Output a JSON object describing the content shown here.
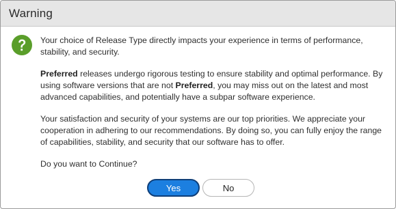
{
  "dialog": {
    "title": "Warning",
    "icon": "question-mark-icon",
    "accent_color": "#5a9e2a",
    "para1": "Your choice of Release Type directly impacts your experience in terms of performance, stability, and security.",
    "para2": {
      "b1": "Preferred",
      "t1": " releases undergo rigorous testing to ensure stability and optimal performance. By using software versions that are not ",
      "b2": "Preferred",
      "t2": ", you may miss out on the latest and most advanced capabilities, and potentially have a subpar software experience."
    },
    "para3": "Your satisfaction and security of your systems are our top priorities. We appreciate your cooperation in adhering to our recommendations. By doing so, you can fully enjoy the range of capabilities, stability, and security that our software has to offer.",
    "question": "Do you want to Continue?",
    "buttons": {
      "yes_label": "Yes",
      "no_label": "No",
      "yes_color": "#1c7fe0"
    }
  }
}
